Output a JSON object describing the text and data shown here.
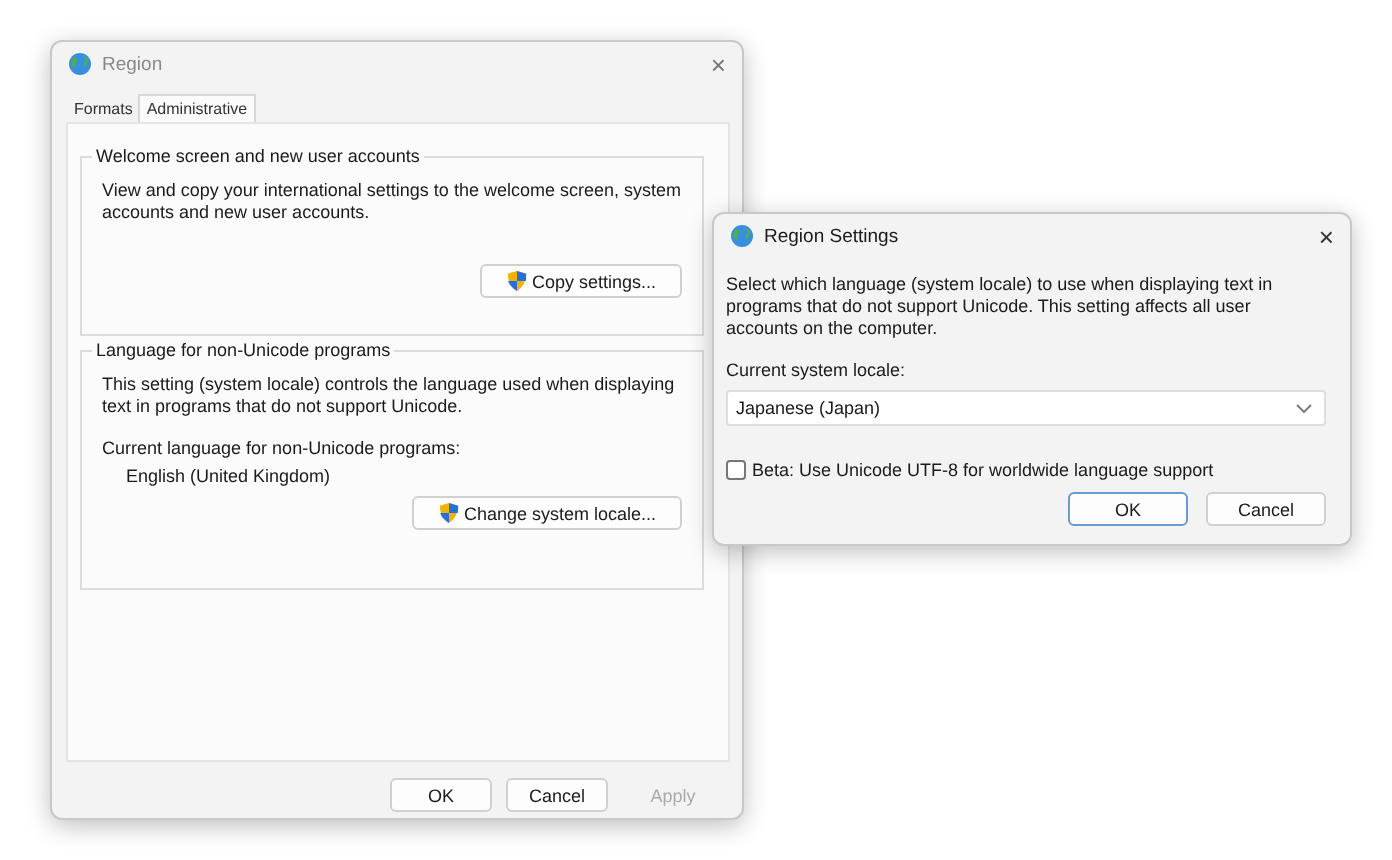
{
  "main_window": {
    "title": "Region",
    "close": "×",
    "tabs": [
      {
        "label": "Formats",
        "selected": false
      },
      {
        "label": "Administrative",
        "selected": true
      }
    ],
    "groups": [
      {
        "title": "Welcome screen and new user accounts",
        "description": "View and copy your international settings to the welcome screen, system accounts and new user accounts.",
        "button": "Copy settings..."
      },
      {
        "title": "Language for non-Unicode programs",
        "description": "This setting (system locale) controls the language used when displaying text in programs that do not support Unicode.",
        "current_label": "Current language for non-Unicode programs:",
        "current_value": "English (United Kingdom)",
        "button": "Change system locale..."
      }
    ],
    "buttons": [
      {
        "label": "OK",
        "disabled": false
      },
      {
        "label": "Cancel",
        "disabled": false
      },
      {
        "label": "Apply",
        "disabled": true
      }
    ]
  },
  "dialog": {
    "title": "Region Settings",
    "close": "×",
    "description": "Select which language (system locale) to use when displaying text in programs that do not support Unicode. This setting affects all user accounts on the computer.",
    "locale_label": "Current system locale:",
    "locale_value": "Japanese (Japan)",
    "beta": {
      "label": "Beta: Use Unicode UTF-8 for worldwide language support",
      "checked": false
    },
    "buttons": [
      {
        "label": "OK",
        "default": true
      },
      {
        "label": "Cancel",
        "default": false
      }
    ]
  }
}
